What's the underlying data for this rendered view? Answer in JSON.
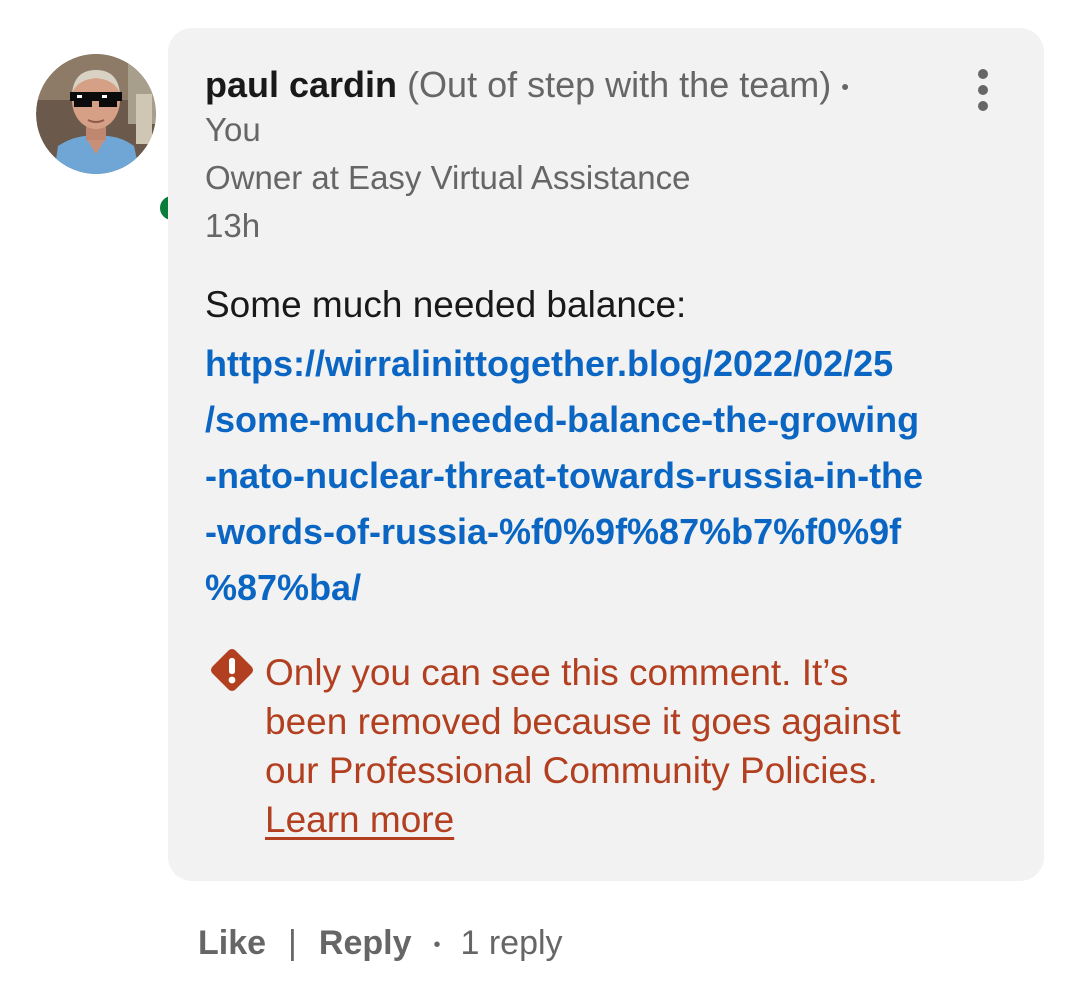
{
  "author": {
    "name": "paul cardin",
    "headline_tag": "(Out of step with the team)",
    "separator": "•",
    "relation": "You",
    "title": "Owner at Easy Virtual Assistance",
    "time": "13h",
    "online_status_color": "#0a7d3a"
  },
  "comment": {
    "text": "Some much needed balance:",
    "link_lines": [
      "https://wirralinittogether.blog/2022/02/25",
      "/some-much-needed-balance-the-growing",
      "-nato-nuclear-threat-towards-russia-in-the",
      "-words-of-russia-%f0%9f%87%b7%f0%9f",
      "%87%ba/"
    ],
    "link_color": "#0a66c2"
  },
  "notice": {
    "icon": "warning-diamond-icon",
    "lines": [
      "Only you can see this comment. It’s",
      "been removed because it goes against",
      "our Professional Community Policies."
    ],
    "learn_more": "Learn more",
    "color": "#b24020"
  },
  "actions": {
    "like": "Like",
    "divider": "|",
    "reply": "Reply",
    "bullet": "•",
    "reply_count": "1 reply"
  },
  "menu": {
    "icon": "more-vertical-icon"
  }
}
